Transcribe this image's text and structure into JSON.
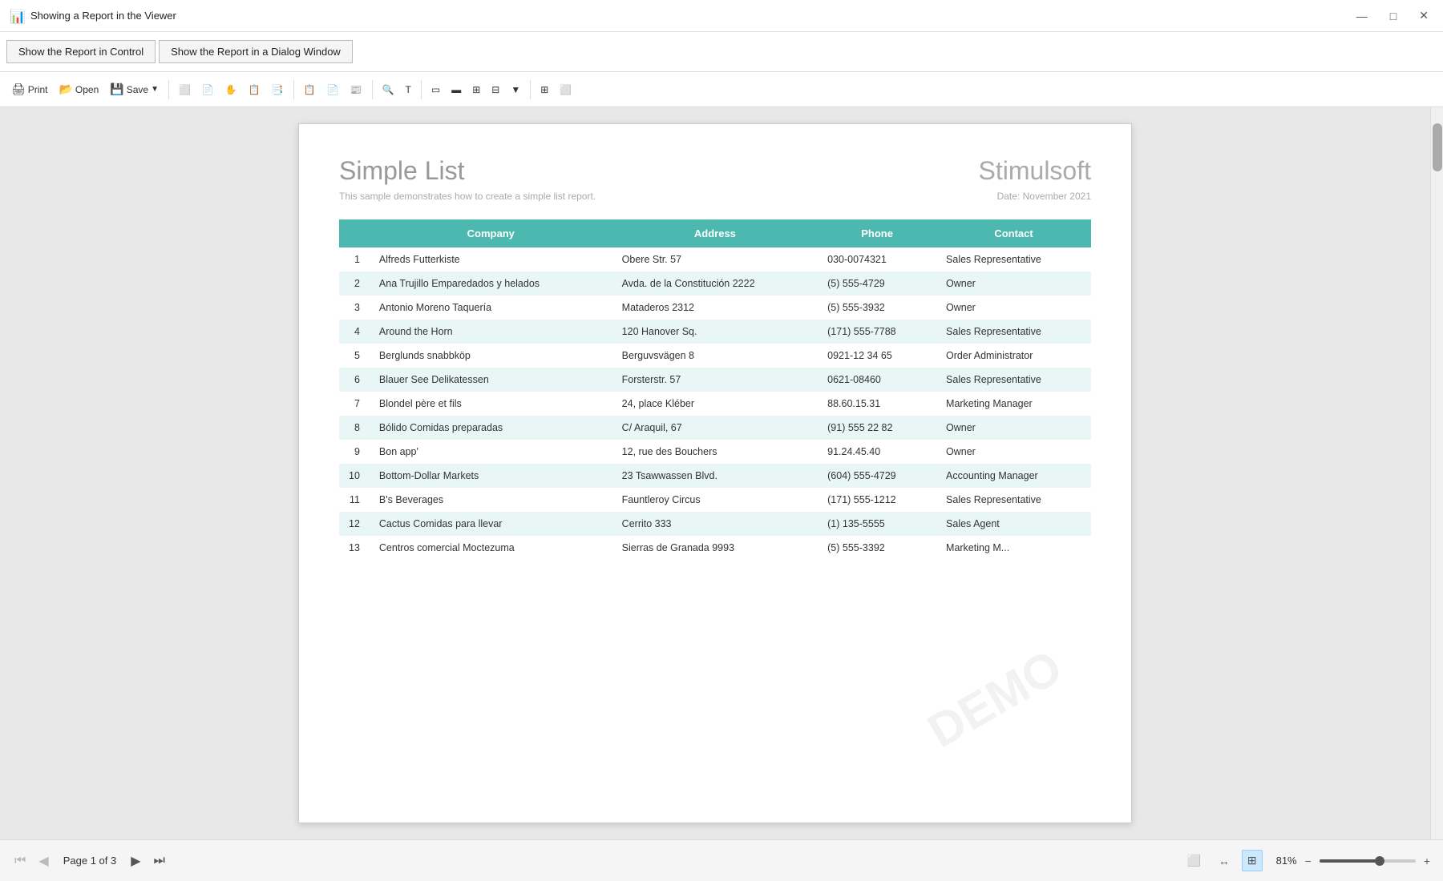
{
  "titlebar": {
    "title": "Showing a Report in the Viewer",
    "icon": "📊",
    "minimize": "—",
    "maximize": "□",
    "close": "✕"
  },
  "buttonbar": {
    "btn1": "Show the Report in Control",
    "btn2": "Show the Report in a Dialog Window"
  },
  "toolbar": {
    "print": "Print",
    "open": "Open",
    "save": "Save",
    "icons": [
      "🖨",
      "📂",
      "💾"
    ]
  },
  "report": {
    "title": "Simple List",
    "brand": "Stimulsoft",
    "subtitle": "This sample demonstrates how to create a simple list report.",
    "date": "Date: November 2021",
    "table": {
      "headers": [
        "Company",
        "Address",
        "Phone",
        "Contact"
      ],
      "rows": [
        [
          1,
          "Alfreds Futterkiste",
          "Obere Str. 57",
          "030-0074321",
          "Sales Representative"
        ],
        [
          2,
          "Ana Trujillo Emparedados y helados",
          "Avda. de la Constitución 2222",
          "(5) 555-4729",
          "Owner"
        ],
        [
          3,
          "Antonio Moreno Taquería",
          "Mataderos  2312",
          "(5) 555-3932",
          "Owner"
        ],
        [
          4,
          "Around the Horn",
          "120 Hanover Sq.",
          "(171) 555-7788",
          "Sales Representative"
        ],
        [
          5,
          "Berglunds snabbköp",
          "Berguvsvägen 8",
          "0921-12 34 65",
          "Order Administrator"
        ],
        [
          6,
          "Blauer See Delikatessen",
          "Forsterstr. 57",
          "0621-08460",
          "Sales Representative"
        ],
        [
          7,
          "Blondel père et fils",
          "24, place Kléber",
          "88.60.15.31",
          "Marketing Manager"
        ],
        [
          8,
          "Bólido Comidas preparadas",
          "C/ Araquil, 67",
          "(91) 555 22 82",
          "Owner"
        ],
        [
          9,
          "Bon app'",
          "12, rue des Bouchers",
          "91.24.45.40",
          "Owner"
        ],
        [
          10,
          "Bottom-Dollar Markets",
          "23 Tsawwassen Blvd.",
          "(604) 555-4729",
          "Accounting Manager"
        ],
        [
          11,
          "B's Beverages",
          "Fauntleroy Circus",
          "(171) 555-1212",
          "Sales Representative"
        ],
        [
          12,
          "Cactus Comidas para llevar",
          "Cerrito 333",
          "(1) 135-5555",
          "Sales Agent"
        ],
        [
          13,
          "Centros comercial Moctezuma",
          "Sierras de Granada 9993",
          "(5) 555-3392",
          "Marketing M..."
        ]
      ]
    }
  },
  "statusbar": {
    "page_info": "Page 1 of 3",
    "zoom": "81%",
    "first_page_label": "⏮",
    "prev_page_label": "◀",
    "next_page_label": "▶",
    "last_page_label": "⏭"
  }
}
